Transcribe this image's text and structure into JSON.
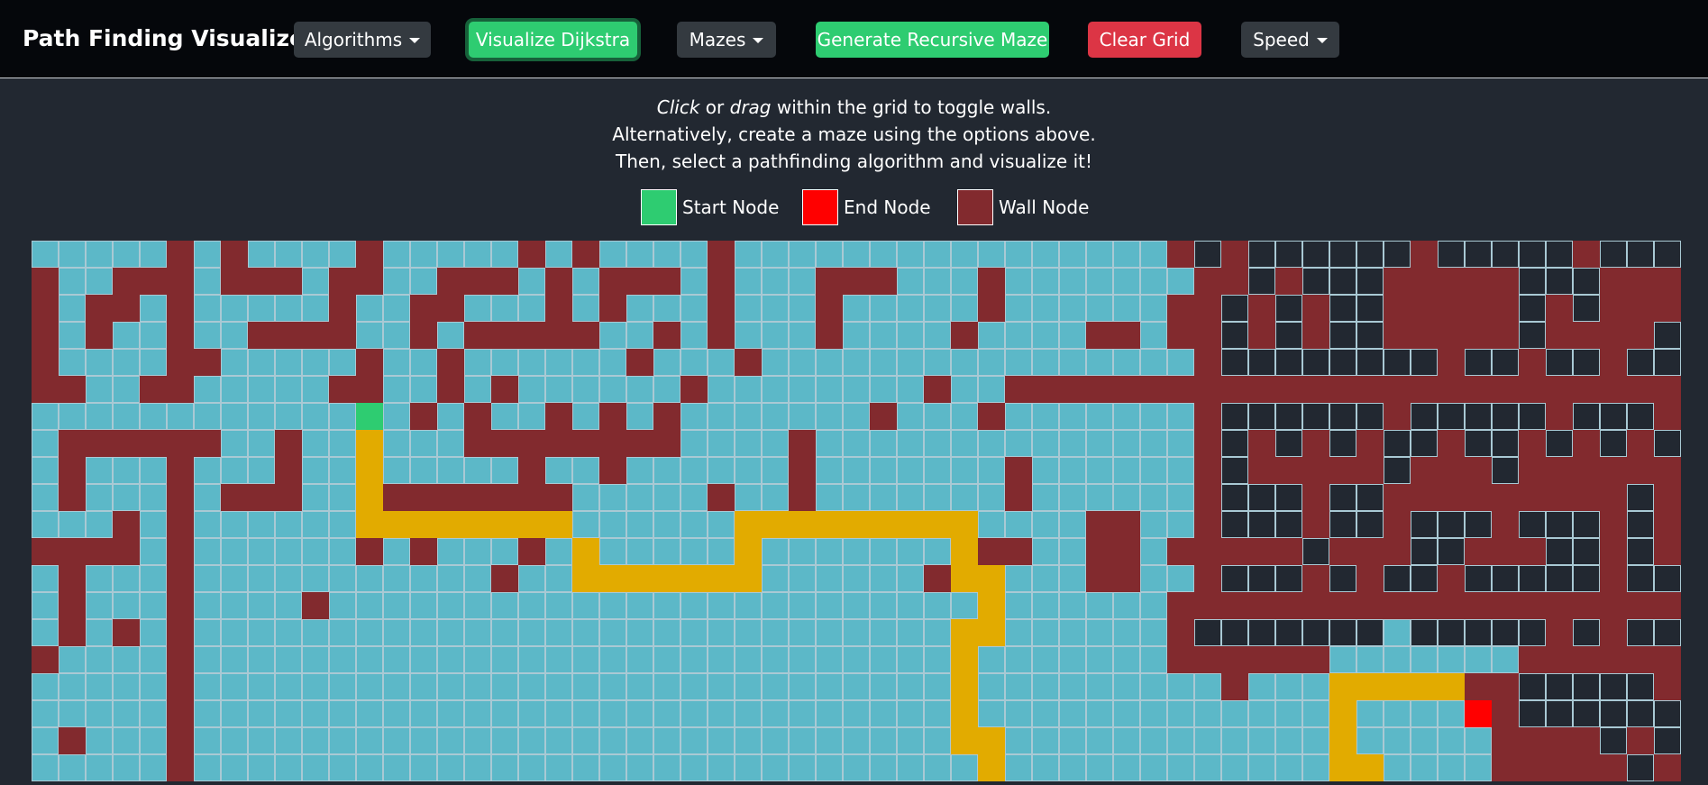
{
  "navbar": {
    "brand": "Path Finding Visualizer",
    "algorithms_label": "Algorithms",
    "visualize_label": "Visualize Dijkstra",
    "mazes_label": "Mazes",
    "generate_maze_label": "Generate Recursive Maze",
    "clear_grid_label": "Clear Grid",
    "speed_label": "Speed"
  },
  "instructions": {
    "line1_em1": "Click",
    "line1_mid": " or ",
    "line1_em2": "drag",
    "line1_end": " within the grid to toggle walls.",
    "line2": "Alternatively, create a maze using the options above.",
    "line3": "Then, select a pathfinding algorithm and visualize it!"
  },
  "legend": {
    "start_label": "Start Node",
    "end_label": "End Node",
    "wall_label": "Wall Node"
  },
  "colors": {
    "start": "#2ecc71",
    "end": "#ff0000",
    "wall": "#822a2e",
    "visited": "#5cb8c8",
    "path": "#e2ab00",
    "unvisited": "#222831"
  },
  "grid": {
    "rows": 20,
    "cols": 61,
    "legend_codes": "W=wall, v=visited, .=unvisited, P=shortest path, S=start, E=end",
    "cells": [
      "vvvvvWvWvvvvWvvvvvWvWvvvvWvvvvvvvvvvvvvvvvW.W......W.....W...",
      "WvvWWWvWWWvWWvvWWWvWvWWWvWvvvWWWvvvWvvvvvvvWW.W...WWWWW...WWW",
      "WvWWvWvvvvvWvvWWvvvWvWvvvWvvvWvvvvvWvvvvvvWW.W.W..WWWWW.W.WWW",
      "WvWvvWvvWWWWvvWvWWWWWvvWvWvvvWvvvvWvvvvWWvWW.W.W..WWWWW.WWWW.",
      "WvvvvWWvvvvvWvvWvvvvvvWvvvWvvvvvvvvvvvvvvvvW........W..W..W..",
      "WWvvWWvvvvvWWvvWvWvvvvvvWvvvvvvvvWvvWWWWWWWWWWWWWWWWWWWWWWWWW",
      "vvvvvvvvvvvvSvWvWvvWvWvWvvvvvvvWvvvWvvvvvvvW......W.....W...W",
      "vWWWWWWvvWvvPvvvWWWWWWWWvvvvWvvvvvvvvvvvvvvW.W.W.W..W..W.W.W.",
      "vWvvvWvvvWvvPvvvvvWvvWvvvvvvWvvvvvvvWvvvvvvW.WWWWW.WWW.WWWWWW",
      "vWvvvWvWWWvvPWWWWWWWvvvvvWvvWvvvvvvvWvvvvvvW...W..WWWWWWWWW.W",
      "vvvWvWvvvvvvPPPPPPPPvvvvvvPPPPPPPPPvvvvWWvvW...W..W...W...W.W",
      "WWWWvWvvvvvvWvWvvvWvPvvvvvPvvvvvvvPWWvvWWvWWWWW.WWW..WWW..W.W",
      "vWvvvWvvvvvvvvvvvWvvPPPPPPPvvvvvvWPPvvvWWvvW...W.W..W.....W..",
      "vWvvvWvvvvWvvvvvvvvvvvvvvvvvvvvvvvvPvvvvvvWWWWWWWWWWWWWWWWWWW",
      "vWvWvWvvvvvvvvvvvvvvvvvvvvvvvvvvvvPPvvvvvvW.......v.....W.W..",
      "WvvvvWvvvvvvvvvvvvvvvvvvvvvvvvvvvvPvvvvvvvWWWWWWvvvvvvvWWWWWW",
      "vvvvvWvvvvvvvvvvvvvvvvvvvvvvvvvvvvPvvvvvvvvvWvvvPPPPPWW.....W",
      "vvvvvWvvvvvvvvvvvvvvvvvvvvvvvvvvvvPvvvvvvvvvvvvvPvvvvEW......",
      "vWvvvWvvvvvvvvvvvvvvvvvvvvvvvvvvvvPPvvvvvvvvvvvvPvvvvvWWWW.W.",
      "vvvvvWvvvvvvvvvvvvvvvvvvvvvvvvvvvvvPvvvvvvvvvvvvPPvvvvWWWWW.W"
    ]
  }
}
